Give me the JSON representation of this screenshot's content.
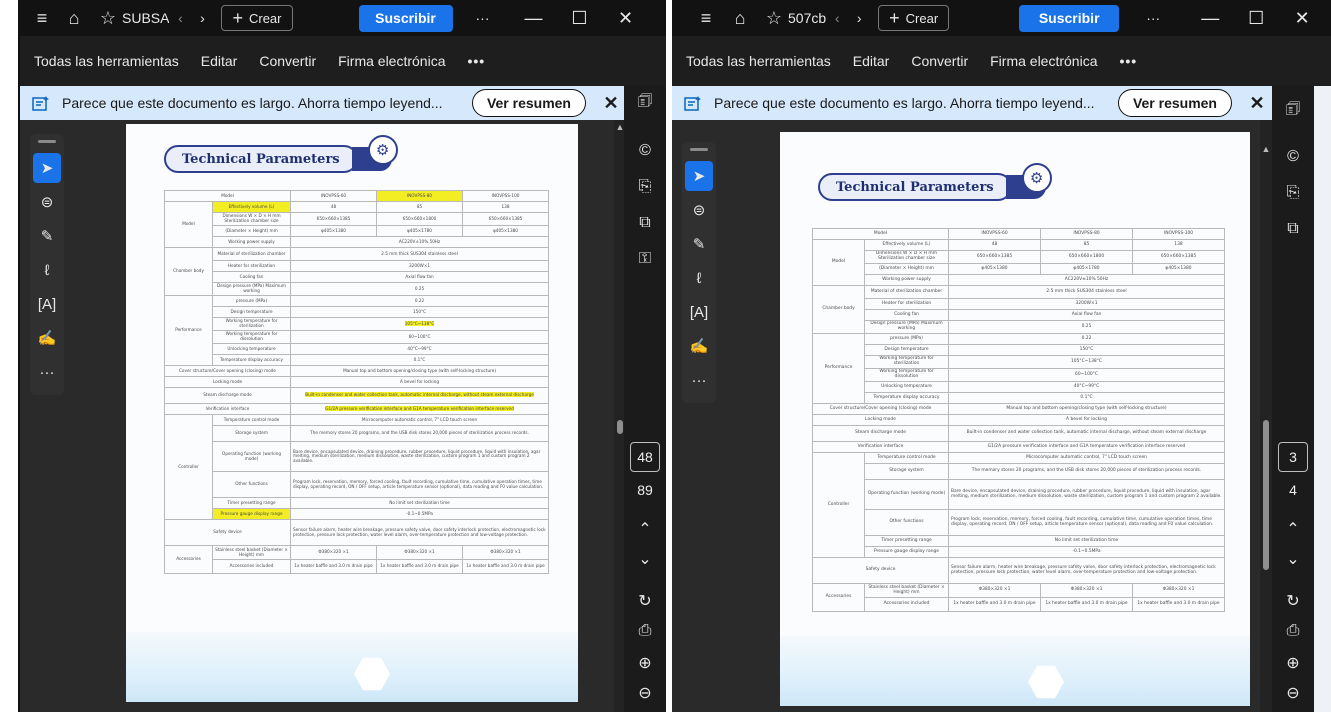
{
  "windows": [
    {
      "id": "left",
      "titlebar": {
        "menu_icon": "hamburger-icon",
        "home_icon": "home-icon",
        "star_icon": "star-icon",
        "tab_title": "SUBSA",
        "create_label": "Crear",
        "subscribe_label": "Suscribir",
        "more_label": "···",
        "minimize": "—",
        "maximize": "☐",
        "close": "✕"
      },
      "menu": [
        "Todas las herramientas",
        "Editar",
        "Convertir",
        "Firma electrónica"
      ],
      "menu_more": "•••",
      "banner": {
        "text": "Parece que este documento es largo. Ahorra tiempo leyend...",
        "button": "Ver resumen",
        "close": "✕"
      },
      "page_indicator": {
        "current": "48",
        "total": "89"
      }
    },
    {
      "id": "right",
      "titlebar": {
        "menu_icon": "hamburger-icon",
        "home_icon": "home-icon",
        "star_icon": "star-icon",
        "tab_title": "507cb",
        "create_label": "Crear",
        "subscribe_label": "Suscribir",
        "more_label": "···",
        "minimize": "—",
        "maximize": "☐",
        "close": "✕"
      },
      "menu": [
        "Todas las herramientas",
        "Editar",
        "Convertir",
        "Firma electrónica"
      ],
      "menu_more": "•••",
      "banner": {
        "text": "Parece que este documento es largo. Ahorra tiempo leyend...",
        "button": "Ver resumen",
        "close": "✕"
      },
      "page_indicator": {
        "current": "3",
        "total": "4"
      }
    }
  ],
  "document": {
    "heading": "Technical Parameters",
    "columns": [
      "Model",
      "INOVPSS-60",
      "INOVPSS-80",
      "INOVPSS-100"
    ],
    "rows": {
      "effective_volume": {
        "label": "Effectively volume (L)",
        "values": [
          "48",
          "85",
          "138"
        ]
      },
      "dimensions": {
        "label": "Dimensions W × D × H mm Sterilization chamber size",
        "values": [
          "650×660×1385",
          "650×660×1800",
          "650×660×1385"
        ]
      },
      "diameter": {
        "label": "(Diameter × Height) mm",
        "values": [
          "φ405×1380",
          "φ405×1780",
          "φ405×1380"
        ]
      },
      "power": {
        "label": "Working power supply",
        "value": "AC220V±10% 50Hz"
      },
      "material": {
        "label": "Material of sterilization chamber",
        "value": "2.5 mm thick SUS304 stainless steel"
      },
      "heater": {
        "label": "Heater for sterilization",
        "value": "3200W×1"
      },
      "cooling": {
        "label": "Cooling fan",
        "value": "Axial flow fan"
      },
      "design_pressure": {
        "label": "Design pressure (MPa) Maximum working",
        "value": "0.25"
      },
      "pressure": {
        "label": "pressure (MPa)",
        "value": "0.22"
      },
      "design_temp": {
        "label": "Design temperature",
        "value": "150°C"
      },
      "working_temp": {
        "label": "Working temperature for sterilization",
        "value": "105°C~138°C"
      },
      "working_temp_dissolution": {
        "label": "Working temperature for dissolution",
        "value": "60~100°C"
      },
      "unlocking_temp": {
        "label": "Unlocking temperature",
        "value": "40°C~99°C"
      },
      "temp_accuracy": {
        "label": "Temperature display accuracy",
        "value": "0.1°C"
      },
      "cover": {
        "label": "Cover structure/Cover opening (closing) mode",
        "value": "Manual top and bottom opening/closing type (with self-locking structure)"
      },
      "locking": {
        "label": "Locking mode",
        "value": "A bevel for locking"
      },
      "steam": {
        "label": "Steam discharge mode",
        "value": "Built-in condenser and water collection tank, automatic internal discharge, without steam external discharge"
      },
      "verification": {
        "label": "Verification interface",
        "value": "G1/2A pressure verification interface and G1A temperature verification interface reserved"
      },
      "controller_group": "Controller",
      "temp_control": {
        "label": "Temperature control mode",
        "value": "Microcomputer automatic control, 7\" LCD touch screen"
      },
      "storage": {
        "label": "Storage system",
        "value": "The memory stores 20 programs, and the USB disk stores 20,000 pieces of sterilization process records."
      },
      "operating": {
        "label": "Operating function (working mode)",
        "value": "Bare device, encapsulated device, draining procedure, rubber procedure, liquid procedure, liquid with insulation, agar melting, medium sterilization, medium dissolution, waste sterilization, custom program 1 and custom program 2 available."
      },
      "other": {
        "label": "Other functions",
        "value": "Program lock, reservation, memory, forced cooling, fault recording, cumulative time, cumulative operation times, time display, operating record, ON / OFF setup, article temperature sensor (optional), data reading and F0 value calculation."
      },
      "timer": {
        "label": "Timer presetting range",
        "value": "No limit set sterilization time"
      },
      "pressure_gauge": {
        "label": "Pressure gauge display range",
        "value": "-0.1~0.5MPa"
      },
      "safety": {
        "label": "Safety device",
        "value": "Sensor failure alarm, heater wire breakage, pressure safety valve, door safety interlock protection, electromagnetic lock protection, pressure lock protection, water level alarm, over-temperature protection and low-voltage protection."
      },
      "accessories_group": "Accessories",
      "basket": {
        "label": "Stainless steel basket (Diameter × Height) mm",
        "values": [
          "Φ380×320 ×1",
          "Φ380×320 ×1",
          "Φ380×320 ×1"
        ]
      },
      "included": {
        "label": "Accessories included",
        "values": [
          "1x heater baffle and 3.0 m drain pipe",
          "1x heater baffle and 3.0 m drain pipe",
          "1x heater baffle and 3.0 m drain pipe"
        ]
      }
    }
  },
  "colors": {
    "accent": "#1a73e8",
    "highlight": "#f3ee23",
    "banner": "#d6e8fb",
    "chrome": "#121212"
  },
  "icons": {
    "tools": [
      "cursor-icon",
      "comment-icon",
      "highlight-pen-icon",
      "draw-icon",
      "text-box-icon",
      "signature-icon",
      "more-tools-icon"
    ],
    "right_panel": [
      "ai-assistant-icon",
      "comment-panel-icon",
      "bookmark-icon",
      "copy-pages-icon",
      "protect-icon"
    ],
    "nav": [
      "chevron-up-icon",
      "chevron-down-icon",
      "refresh-icon",
      "save-icon",
      "zoom-in-icon",
      "zoom-out-icon"
    ]
  }
}
